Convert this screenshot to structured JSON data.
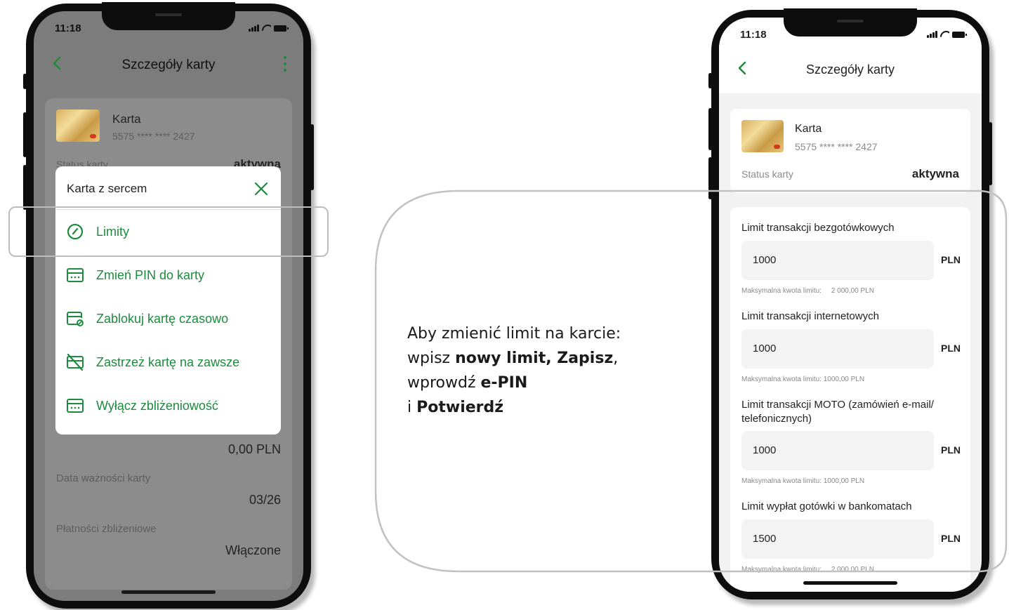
{
  "phone_left": {
    "status_time": "11:18",
    "header_title": "Szczegóły karty",
    "card": {
      "name": "Karta",
      "number": "5575 **** **** 2427"
    },
    "status": {
      "label": "Status karty",
      "value": "aktywna"
    },
    "popup": {
      "title": "Karta z sercem",
      "items": [
        {
          "label": "Limity",
          "icon": "gauge-icon"
        },
        {
          "label": "Zmień PIN do karty",
          "icon": "pin-card-icon"
        },
        {
          "label": "Zablokuj kartę czasowo",
          "icon": "card-lock-icon"
        },
        {
          "label": "Zastrzeż kartę na zawsze",
          "icon": "card-cancel-icon"
        },
        {
          "label": "Wyłącz zbliżeniowość",
          "icon": "contactless-card-icon"
        }
      ]
    },
    "amount_value": "0,00 PLN",
    "expiry": {
      "label": "Data ważności karty",
      "value": "03/26"
    },
    "contactless": {
      "label": "Płatności zbliżeniowe",
      "value": "Włączone"
    }
  },
  "instruction": {
    "line1": "Aby zmienić limit na karcie:",
    "line2_prefix": "wpisz ",
    "line2_bold": "nowy limit, Zapisz",
    "line2_suffix": ",",
    "line3_prefix": "wprowdź ",
    "line3_bold": "e-PIN",
    "line4_prefix": "i ",
    "line4_bold": "Potwierdź"
  },
  "phone_right": {
    "status_time": "11:18",
    "header_title": "Szczegóły karty",
    "card": {
      "name": "Karta",
      "number": "5575 **** **** 2427"
    },
    "status": {
      "label": "Status karty",
      "value": "aktywna"
    },
    "limits": [
      {
        "title": "Limit transakcji bezgotówkowych",
        "value": "1000",
        "currency": "PLN",
        "max": "Maksymalna kwota limitu:     2 000,00 PLN"
      },
      {
        "title": "Limit transakcji internetowych",
        "value": "1000",
        "currency": "PLN",
        "max": "Maksymalna kwota limitu: 1000,00 PLN"
      },
      {
        "title": "Limit transakcji MOTO (zamówień e-mail/ telefonicznych)",
        "value": "1000",
        "currency": "PLN",
        "max": "Maksymalna kwota limitu: 1000,00 PLN"
      },
      {
        "title": "Limit wypłat gotówki w bankomatach",
        "value": "1500",
        "currency": "PLN",
        "max": "Maksymalna kwota limitu:     2 000,00 PLN"
      }
    ]
  },
  "colors": {
    "accent_green": "#1e8a3e",
    "overlay_gray": "#7c7c7c"
  }
}
